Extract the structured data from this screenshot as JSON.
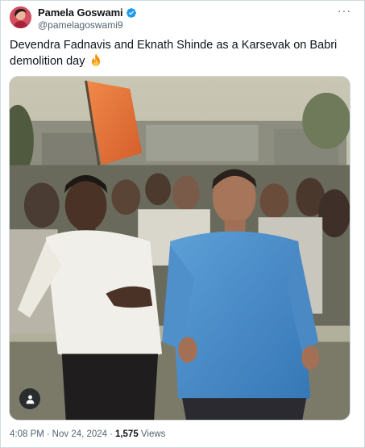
{
  "author": {
    "display_name": "Pamela Goswami",
    "handle": "@pamelagoswami9",
    "verified": true,
    "verified_color": "#1d9bf0"
  },
  "tweet": {
    "text": "Devendra Fadnavis and Eknath Shinde as a Karsevak on Babri demolition day",
    "emoji_icon": "fire-icon"
  },
  "media": {
    "tag_icon": "person-icon"
  },
  "meta": {
    "time": "4:08 PM",
    "separator": "·",
    "date": "Nov 24, 2024",
    "views_count": "1,575",
    "views_label": "Views"
  },
  "menu": {
    "more_icon": "more-horizontal-icon",
    "more_label": "···"
  }
}
